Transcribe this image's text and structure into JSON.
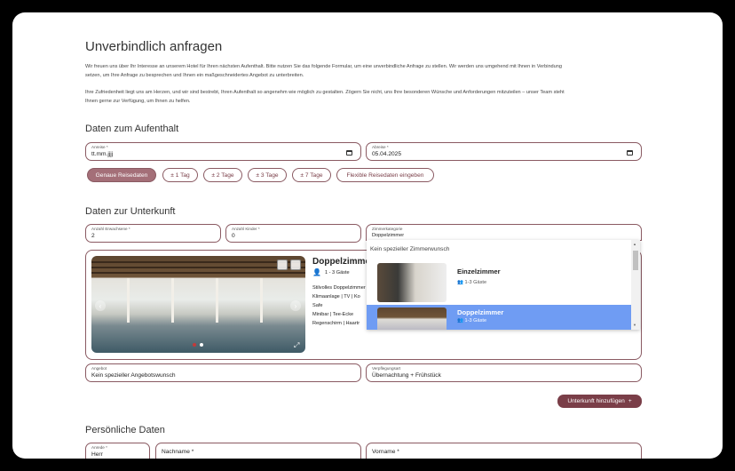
{
  "page": {
    "title": "Unverbindlich anfragen",
    "intro1": "Wir freuen uns über Ihr Interesse an unserem Hotel für Ihren nächsten Aufenthalt. Bitte nutzen Sie das folgende Formular, um eine unverbindliche Anfrage zu stellen. Wir werden uns umgehend mit Ihnen in Verbindung",
    "intro1b": "setzen, um Ihre Anfrage zu besprechen und Ihnen ein maßgeschneidertes Angebot zu unterbreiten.",
    "intro2": "Ihre Zufriedenheit liegt uns am Herzen, und wir sind bestrebt, Ihren Aufenthalt so angenehm wie möglich zu gestalten. Zögern Sie nicht, uns Ihre besonderen Wünsche und Anforderungen mitzuteilen – unser Team steht",
    "intro2b": "Ihnen gerne zur Verfügung, um Ihnen zu helfen."
  },
  "stay": {
    "heading": "Daten zum Aufenthalt",
    "arrival_label": "Anreise *",
    "arrival_value": "tt.mm.jjjj",
    "departure_label": "Abreise *",
    "departure_value": "05.04.2025",
    "chips": [
      "Genaue Reisedaten",
      "± 1 Tag",
      "± 2 Tage",
      "± 3 Tage",
      "± 7 Tage",
      "Flexible Reisedaten eingeben"
    ]
  },
  "accommodation": {
    "heading": "Daten zur Unterkunft",
    "adults_label": "Anzahl Erwachsene *",
    "adults_value": "2",
    "children_label": "Anzahl Kinder *",
    "children_value": "0",
    "category_label": "Zimmerkategorie",
    "category_value": "Doppelzimmer",
    "room_title": "Doppelzimmer",
    "room_guests": "1 - 3 Gäste",
    "room_desc": [
      "Stilvolles Doppelzimmer",
      "Klimaanlage | TV | Ko",
      "Safe",
      "Minibar | Tee-Ecke",
      "Regenschirm | Haartr"
    ],
    "dropdown": {
      "none_option": "Kein spezieller Zimmerwunsch",
      "options": [
        {
          "name": "Einzelzimmer",
          "guests": "1-3 Gäste"
        },
        {
          "name": "Doppelzimmer",
          "guests": "1-3 Gäste"
        }
      ]
    },
    "offer_label": "Angebot",
    "offer_value": "Kein spezieller Angebotswunsch",
    "board_label": "Verpflegungsart",
    "board_value": "Übernachtung + Frühstück",
    "add_button": "Unterkunft hinzufügen",
    "add_icon": "+"
  },
  "personal": {
    "heading": "Persönliche Daten",
    "salutation_label": "Anrede *",
    "salutation_value": "Herr",
    "lastname_label": "Nachname *",
    "firstname_label": "Vorname *"
  },
  "colors": {
    "accent": "#7a3e48",
    "selected": "#6f9cf3"
  }
}
